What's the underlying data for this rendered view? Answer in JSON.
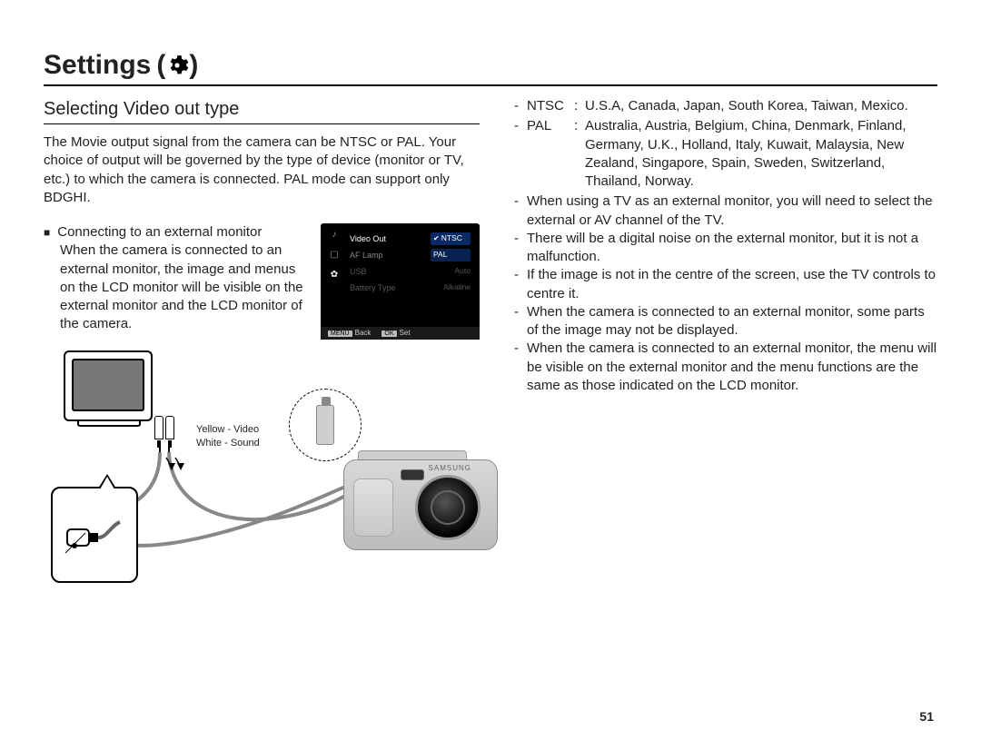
{
  "title": "Settings",
  "title_paren_open": "(",
  "title_paren_close": ")",
  "subheading": "Selecting Video out type",
  "intro": "The Movie output signal from the camera can be NTSC or PAL. Your choice of output will be governed by the type of device (monitor or TV, etc.) to which the camera is connected. PAL mode can support only BDGHI.",
  "connect": {
    "heading": "Connecting to an external monitor",
    "body": "When the camera is connected to an external monitor, the image and menus on the LCD monitor will be visible on the external monitor and the LCD monitor of the camera."
  },
  "lcd": {
    "rows": [
      {
        "label": "Video Out",
        "opt": "NTSC",
        "selected": true,
        "checked": true
      },
      {
        "label": "AF Lamp",
        "opt": "PAL",
        "selected": false,
        "checked": false
      },
      {
        "label": "USB",
        "opt": "Auto",
        "selected": false,
        "dim": true
      },
      {
        "label": "Battery Type",
        "opt": "Alkaline",
        "selected": false,
        "dim": true
      }
    ],
    "footer_back_btn": "MENU",
    "footer_back": "Back",
    "footer_set_btn": "OK",
    "footer_set": "Set"
  },
  "cable_labels": {
    "video": "Yellow - Video",
    "sound": "White - Sound"
  },
  "right": {
    "regions": [
      {
        "label": "NTSC",
        "value": "U.S.A, Canada, Japan, South Korea, Taiwan, Mexico."
      },
      {
        "label": "PAL",
        "value": "Australia, Austria, Belgium, China, Denmark, Finland, Germany, U.K., Holland, Italy, Kuwait, Malaysia, New Zealand, Singapore, Spain, Sweden, Switzerland, Thailand, Norway."
      }
    ],
    "notes": [
      "When using a TV as an external monitor, you will need to select the external or AV channel of the TV.",
      "There will be a digital noise on the external monitor, but it is not a malfunction.",
      "If the image is not in the centre of the screen, use the TV controls to centre it.",
      "When the camera is connected to an external monitor, some parts of the image may not be displayed.",
      "When the camera is connected to an external monitor, the menu will be visible on the external monitor and the menu functions are the same as those indicated on the LCD monitor."
    ]
  },
  "camera_brand": "SAMSUNG",
  "page_number": "51"
}
